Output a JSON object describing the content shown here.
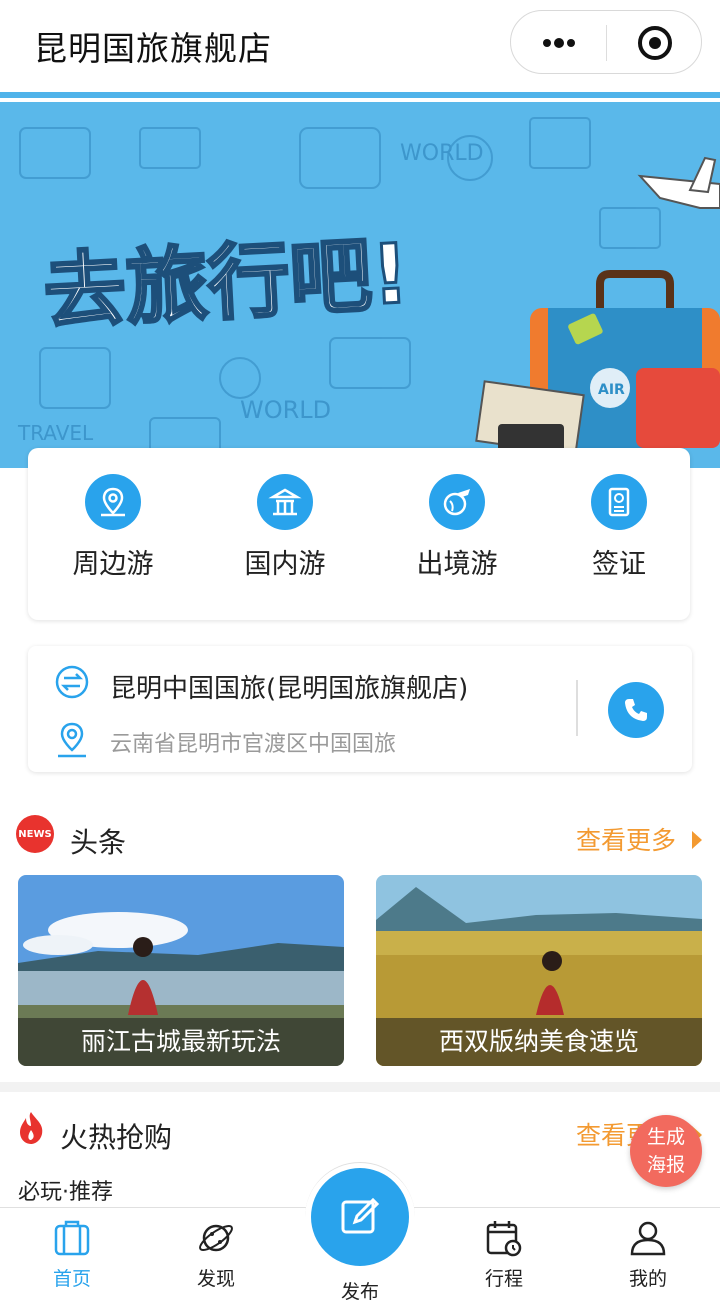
{
  "header": {
    "title": "昆明国旅旗舰店"
  },
  "banner": {
    "headline": "去旅行吧!",
    "tags": [
      "WORLD",
      "TRAVEL",
      "AIR"
    ]
  },
  "categories": [
    {
      "label": "周边游",
      "icon": "location-map-icon"
    },
    {
      "label": "国内游",
      "icon": "temple-icon"
    },
    {
      "label": "出境游",
      "icon": "globe-plane-icon"
    },
    {
      "label": "签证",
      "icon": "passport-icon"
    }
  ],
  "store": {
    "name": "昆明中国国旅(昆明国旅旗舰店)",
    "address": "云南省昆明市官渡区中国国旅"
  },
  "news": {
    "badge": "NEWS",
    "title": "头条",
    "more": "查看更多",
    "items": [
      {
        "caption": "丽江古城最新玩法"
      },
      {
        "caption": "西双版纳美食速览"
      }
    ]
  },
  "hot": {
    "title": "火热抢购",
    "more": "查看更多",
    "subtitle": "必玩·推荐"
  },
  "poster_button": {
    "line1": "生成",
    "line2": "海报"
  },
  "tabbar": {
    "tabs": [
      {
        "label": "首页"
      },
      {
        "label": "发现"
      },
      {
        "label": "发布"
      },
      {
        "label": "行程"
      },
      {
        "label": "我的"
      }
    ]
  },
  "colors": {
    "accent": "#29a3ec",
    "more": "#f39a31",
    "poster": "#f26a5e",
    "news": "#e8332e"
  }
}
